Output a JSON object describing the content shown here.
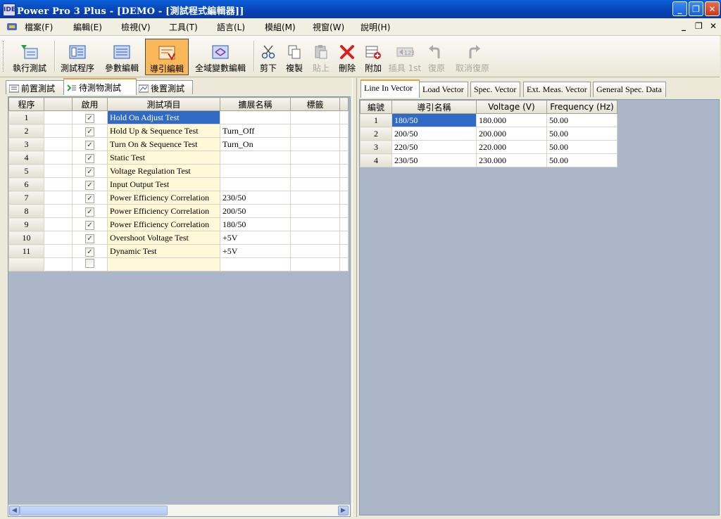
{
  "window": {
    "app_icon_text": "IDE",
    "title": "Power Pro 3 Plus - [DEMO - [測試程式編輯器]]",
    "minimize_glyph": "_",
    "maximize_glyph": "❐",
    "close_glyph": "✕"
  },
  "menu": {
    "items": [
      "檔案(F)",
      "編輯(E)",
      "檢視(V)",
      "工具(T)",
      "語言(L)",
      "模組(M)",
      "視窗(W)",
      "說明(H)"
    ],
    "mdi_minimize": "_",
    "mdi_restore": "❐",
    "mdi_close": "✕"
  },
  "toolbar": {
    "run_test": "執行測試",
    "test_program": "測試程序",
    "param_edit": "參數編輯",
    "guide_edit": "導引編輯",
    "global_var_edit": "全域變數編輯",
    "cut": "剪下",
    "copy": "複製",
    "paste": "貼上",
    "delete": "刪除",
    "append": "附加",
    "insert_first": "插具 1st",
    "undo": "復原",
    "redo": "取消復原"
  },
  "left_tabs": [
    "前置測試",
    "待測物測試",
    "後置測試"
  ],
  "left_table": {
    "headers": [
      "程序",
      "",
      "啟用",
      "測試項目",
      "擴展名稱",
      "標籤"
    ],
    "rows": [
      {
        "no": "1",
        "enabled": true,
        "item": "Hold On Adjust Test",
        "ext": ""
      },
      {
        "no": "2",
        "enabled": true,
        "item": "Hold Up & Sequence Test",
        "ext": "Turn_Off"
      },
      {
        "no": "3",
        "enabled": true,
        "item": "Turn On & Sequence Test",
        "ext": "Turn_On"
      },
      {
        "no": "4",
        "enabled": true,
        "item": "Static Test",
        "ext": ""
      },
      {
        "no": "5",
        "enabled": true,
        "item": "Voltage Regulation Test",
        "ext": ""
      },
      {
        "no": "6",
        "enabled": true,
        "item": "Input Output Test",
        "ext": ""
      },
      {
        "no": "7",
        "enabled": true,
        "item": "Power Efficiency Correlation",
        "ext": "230/50"
      },
      {
        "no": "8",
        "enabled": true,
        "item": "Power Efficiency Correlation",
        "ext": "200/50"
      },
      {
        "no": "9",
        "enabled": true,
        "item": "Power Efficiency Correlation",
        "ext": "180/50"
      },
      {
        "no": "10",
        "enabled": true,
        "item": "Overshoot Voltage Test",
        "ext": "+5V"
      },
      {
        "no": "11",
        "enabled": true,
        "item": "Dynamic Test",
        "ext": "+5V"
      },
      {
        "no": "",
        "enabled": false,
        "item": "",
        "ext": ""
      }
    ],
    "check_glyph": "✓"
  },
  "right_tabs": [
    "Line In Vector",
    "Load Vector",
    "Spec. Vector",
    "Ext. Meas. Vector",
    "General Spec. Data"
  ],
  "right_table": {
    "headers": [
      "編號",
      "導引名稱",
      "Voltage (V)",
      "Frequency (Hz)"
    ],
    "rows": [
      {
        "no": "1",
        "name": "180/50",
        "voltage": "180.000",
        "freq": "50.00"
      },
      {
        "no": "2",
        "name": "200/50",
        "voltage": "200.000",
        "freq": "50.00"
      },
      {
        "no": "3",
        "name": "220/50",
        "voltage": "220.000",
        "freq": "50.00"
      },
      {
        "no": "4",
        "name": "230/50",
        "voltage": "230.000",
        "freq": "50.00"
      }
    ]
  }
}
